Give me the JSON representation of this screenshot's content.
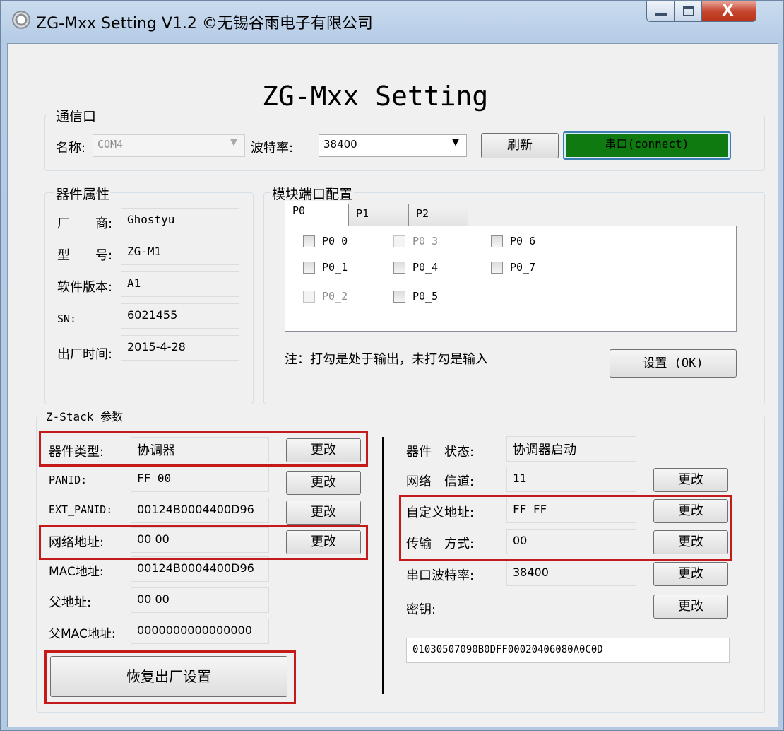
{
  "window": {
    "title": "ZG-Mxx Setting V1.2 ©无锡谷雨电子有限公司",
    "close_glyph": "X"
  },
  "app_title": "ZG-Mxx Setting",
  "comm": {
    "group_label": "通信口",
    "name_label": "名称:",
    "port_value": "COM4",
    "baud_label": "波特率:",
    "baud_value": "38400",
    "refresh_label": "刷新",
    "connect_label": "串口(connect)",
    "connect_color": "#0f7a0f"
  },
  "device": {
    "group_label": "器件属性",
    "vendor_label": "厂　　商:",
    "vendor_value": "Ghostyu",
    "model_label": "型　　号:",
    "model_value": "ZG-M1",
    "sw_label": "软件版本:",
    "sw_value": "A1",
    "sn_label": "SN:",
    "sn_value": "6021455",
    "date_label": "出厂时间:",
    "date_value": "2015-4-28"
  },
  "ports": {
    "group_label": "模块端口配置",
    "tabs": [
      "P0",
      "P1",
      "P2"
    ],
    "checkboxes": [
      {
        "label": "P0_0",
        "enabled": true
      },
      {
        "label": "P0_1",
        "enabled": true
      },
      {
        "label": "P0_2",
        "enabled": false
      },
      {
        "label": "P0_3",
        "enabled": false
      },
      {
        "label": "P0_4",
        "enabled": true
      },
      {
        "label": "P0_5",
        "enabled": true
      },
      {
        "label": "P0_6",
        "enabled": true
      },
      {
        "label": "P0_7",
        "enabled": true
      }
    ],
    "note": "注：打勾是处于输出，未打勾是输入",
    "set_button": "设置 (OK)"
  },
  "zstack": {
    "group_label": "Z-Stack 参数",
    "change_label": "更改",
    "device_type_label": "器件类型:",
    "device_type_value": "协调器",
    "panid_label": "PANID:",
    "panid_value": "FF 00",
    "ext_panid_label": "EXT_PANID:",
    "ext_panid_value": "00124B0004400D96",
    "net_addr_label": "网络地址:",
    "net_addr_value": "00 00",
    "mac_label": "MAC地址:",
    "mac_value": "00124B0004400D96",
    "parent_label": "父地址:",
    "parent_value": "00 00",
    "parent_mac_label": "父MAC地址:",
    "parent_mac_value": "0000000000000000",
    "factory_reset": "恢复出厂设置",
    "status_label": "器件　状态:",
    "status_value": "协调器启动",
    "channel_label": "网络　信道:",
    "channel_value": "11",
    "custom_addr_label": "自定义地址:",
    "custom_addr_value": "FF FF",
    "transfer_label": "传输　方式:",
    "transfer_value": "00",
    "uart_baud_label": "串口波特率:",
    "uart_baud_value": "38400",
    "key_label": "密钥:",
    "key_value": "01030507090B0DFF00020406080A0C0D",
    "highlight_color": "#c41a1a"
  }
}
